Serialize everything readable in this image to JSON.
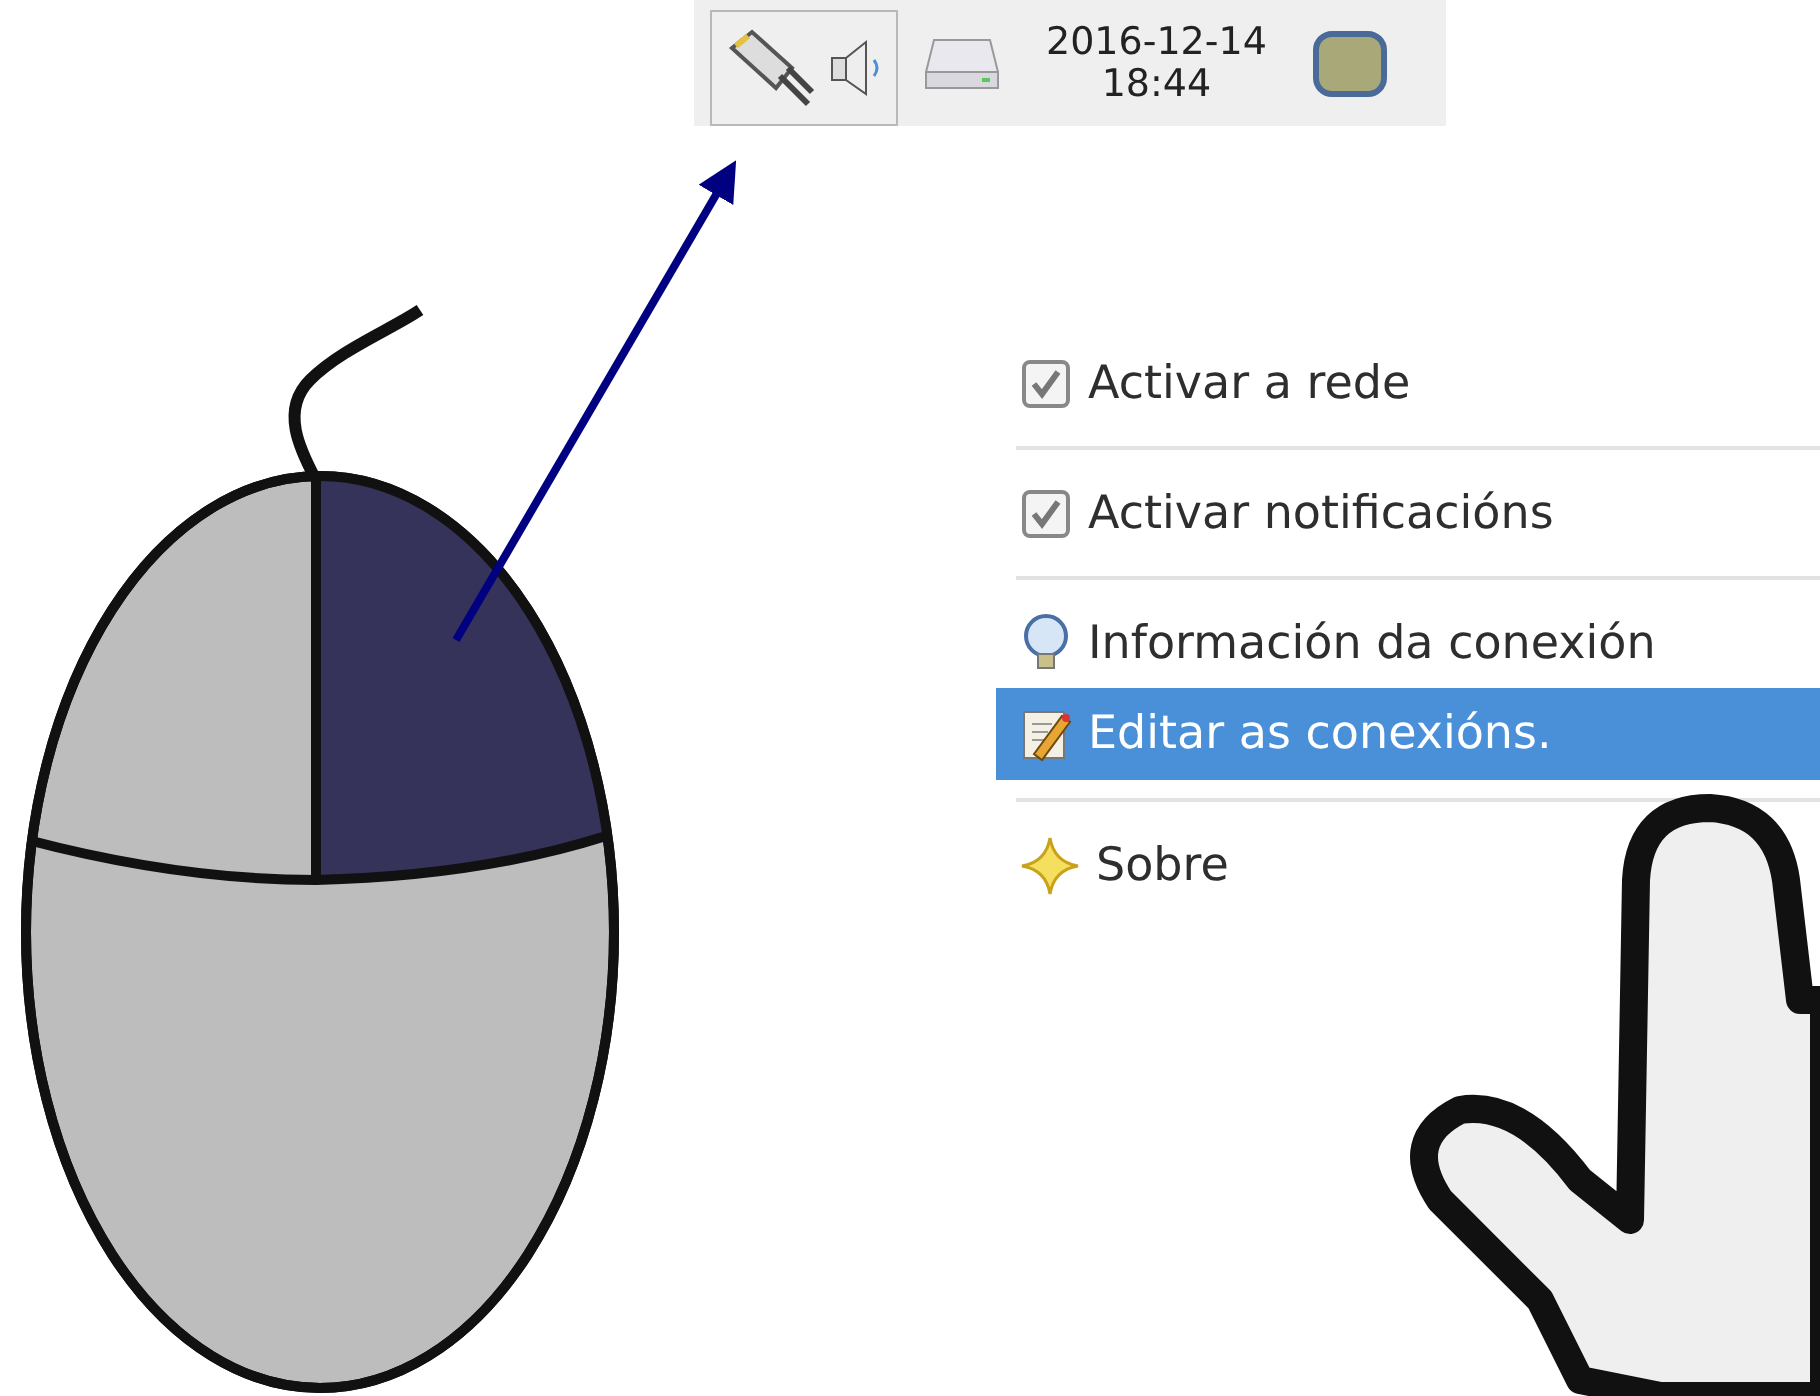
{
  "tray": {
    "clock": {
      "date": "2016-12-14",
      "time": "18:44"
    }
  },
  "menu": {
    "items": [
      {
        "kind": "checkbox",
        "label": "Activar a rede",
        "checked": true,
        "selected": false
      },
      {
        "kind": "separator"
      },
      {
        "kind": "checkbox",
        "label": "Activar notificacións",
        "checked": true,
        "selected": false
      },
      {
        "kind": "separator"
      },
      {
        "kind": "info",
        "label": "Información da conexión",
        "selected": false
      },
      {
        "kind": "edit",
        "label": "Editar as conexións.",
        "selected": true
      },
      {
        "kind": "separator"
      },
      {
        "kind": "about",
        "label": "Sobre",
        "selected": false
      }
    ]
  }
}
